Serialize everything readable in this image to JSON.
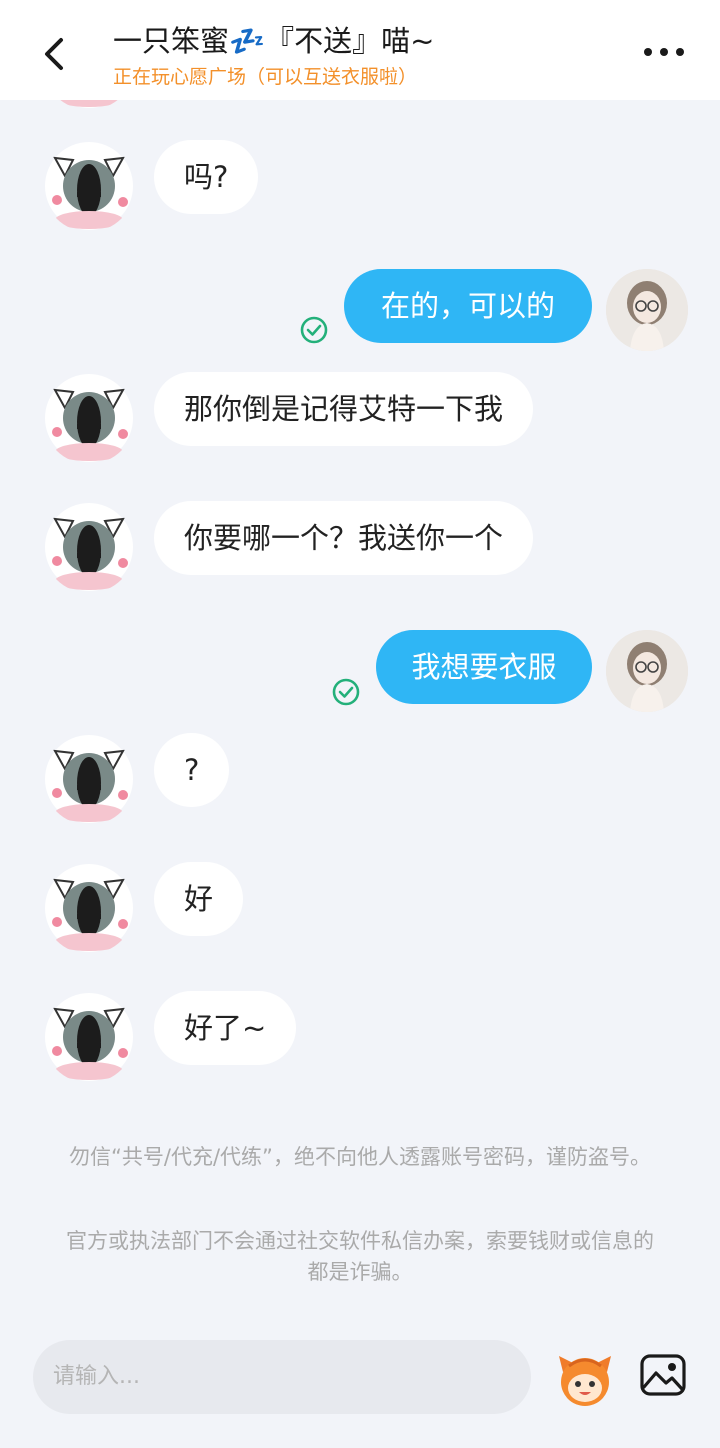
{
  "header": {
    "title": "一只笨蜜💤『不送』喵~",
    "subtitle": "正在玩心愿广场（可以互送衣服啦）"
  },
  "messages": [
    {
      "side": "in",
      "text": "吗?"
    },
    {
      "side": "out",
      "text": "在的，可以的"
    },
    {
      "side": "in",
      "text": "那你倒是记得艾特一下我"
    },
    {
      "side": "in",
      "text": "你要哪一个？我送你一个"
    },
    {
      "side": "out",
      "text": "我想要衣服"
    },
    {
      "side": "in",
      "text": "?"
    },
    {
      "side": "in",
      "text": "好"
    },
    {
      "side": "in",
      "text": "好了~"
    }
  ],
  "notices": {
    "fraud_1": "勿信“共号/代充/代练”，绝不向他人透露账号密码，谨防盗号。",
    "fraud_2": "官方或执法部门不会通过社交软件私信办案，索要钱财或信息的都是诈骗。"
  },
  "footer": {
    "input_placeholder": "请输入..."
  },
  "colors": {
    "accent_blue": "#2fb6f5",
    "status_orange": "#f3902a",
    "read_green": "#23b07a",
    "background": "#f2f4f9"
  },
  "icons": [
    "back-arrow-icon",
    "more-icon",
    "read-check-icon",
    "emoji-icon",
    "image-icon"
  ]
}
